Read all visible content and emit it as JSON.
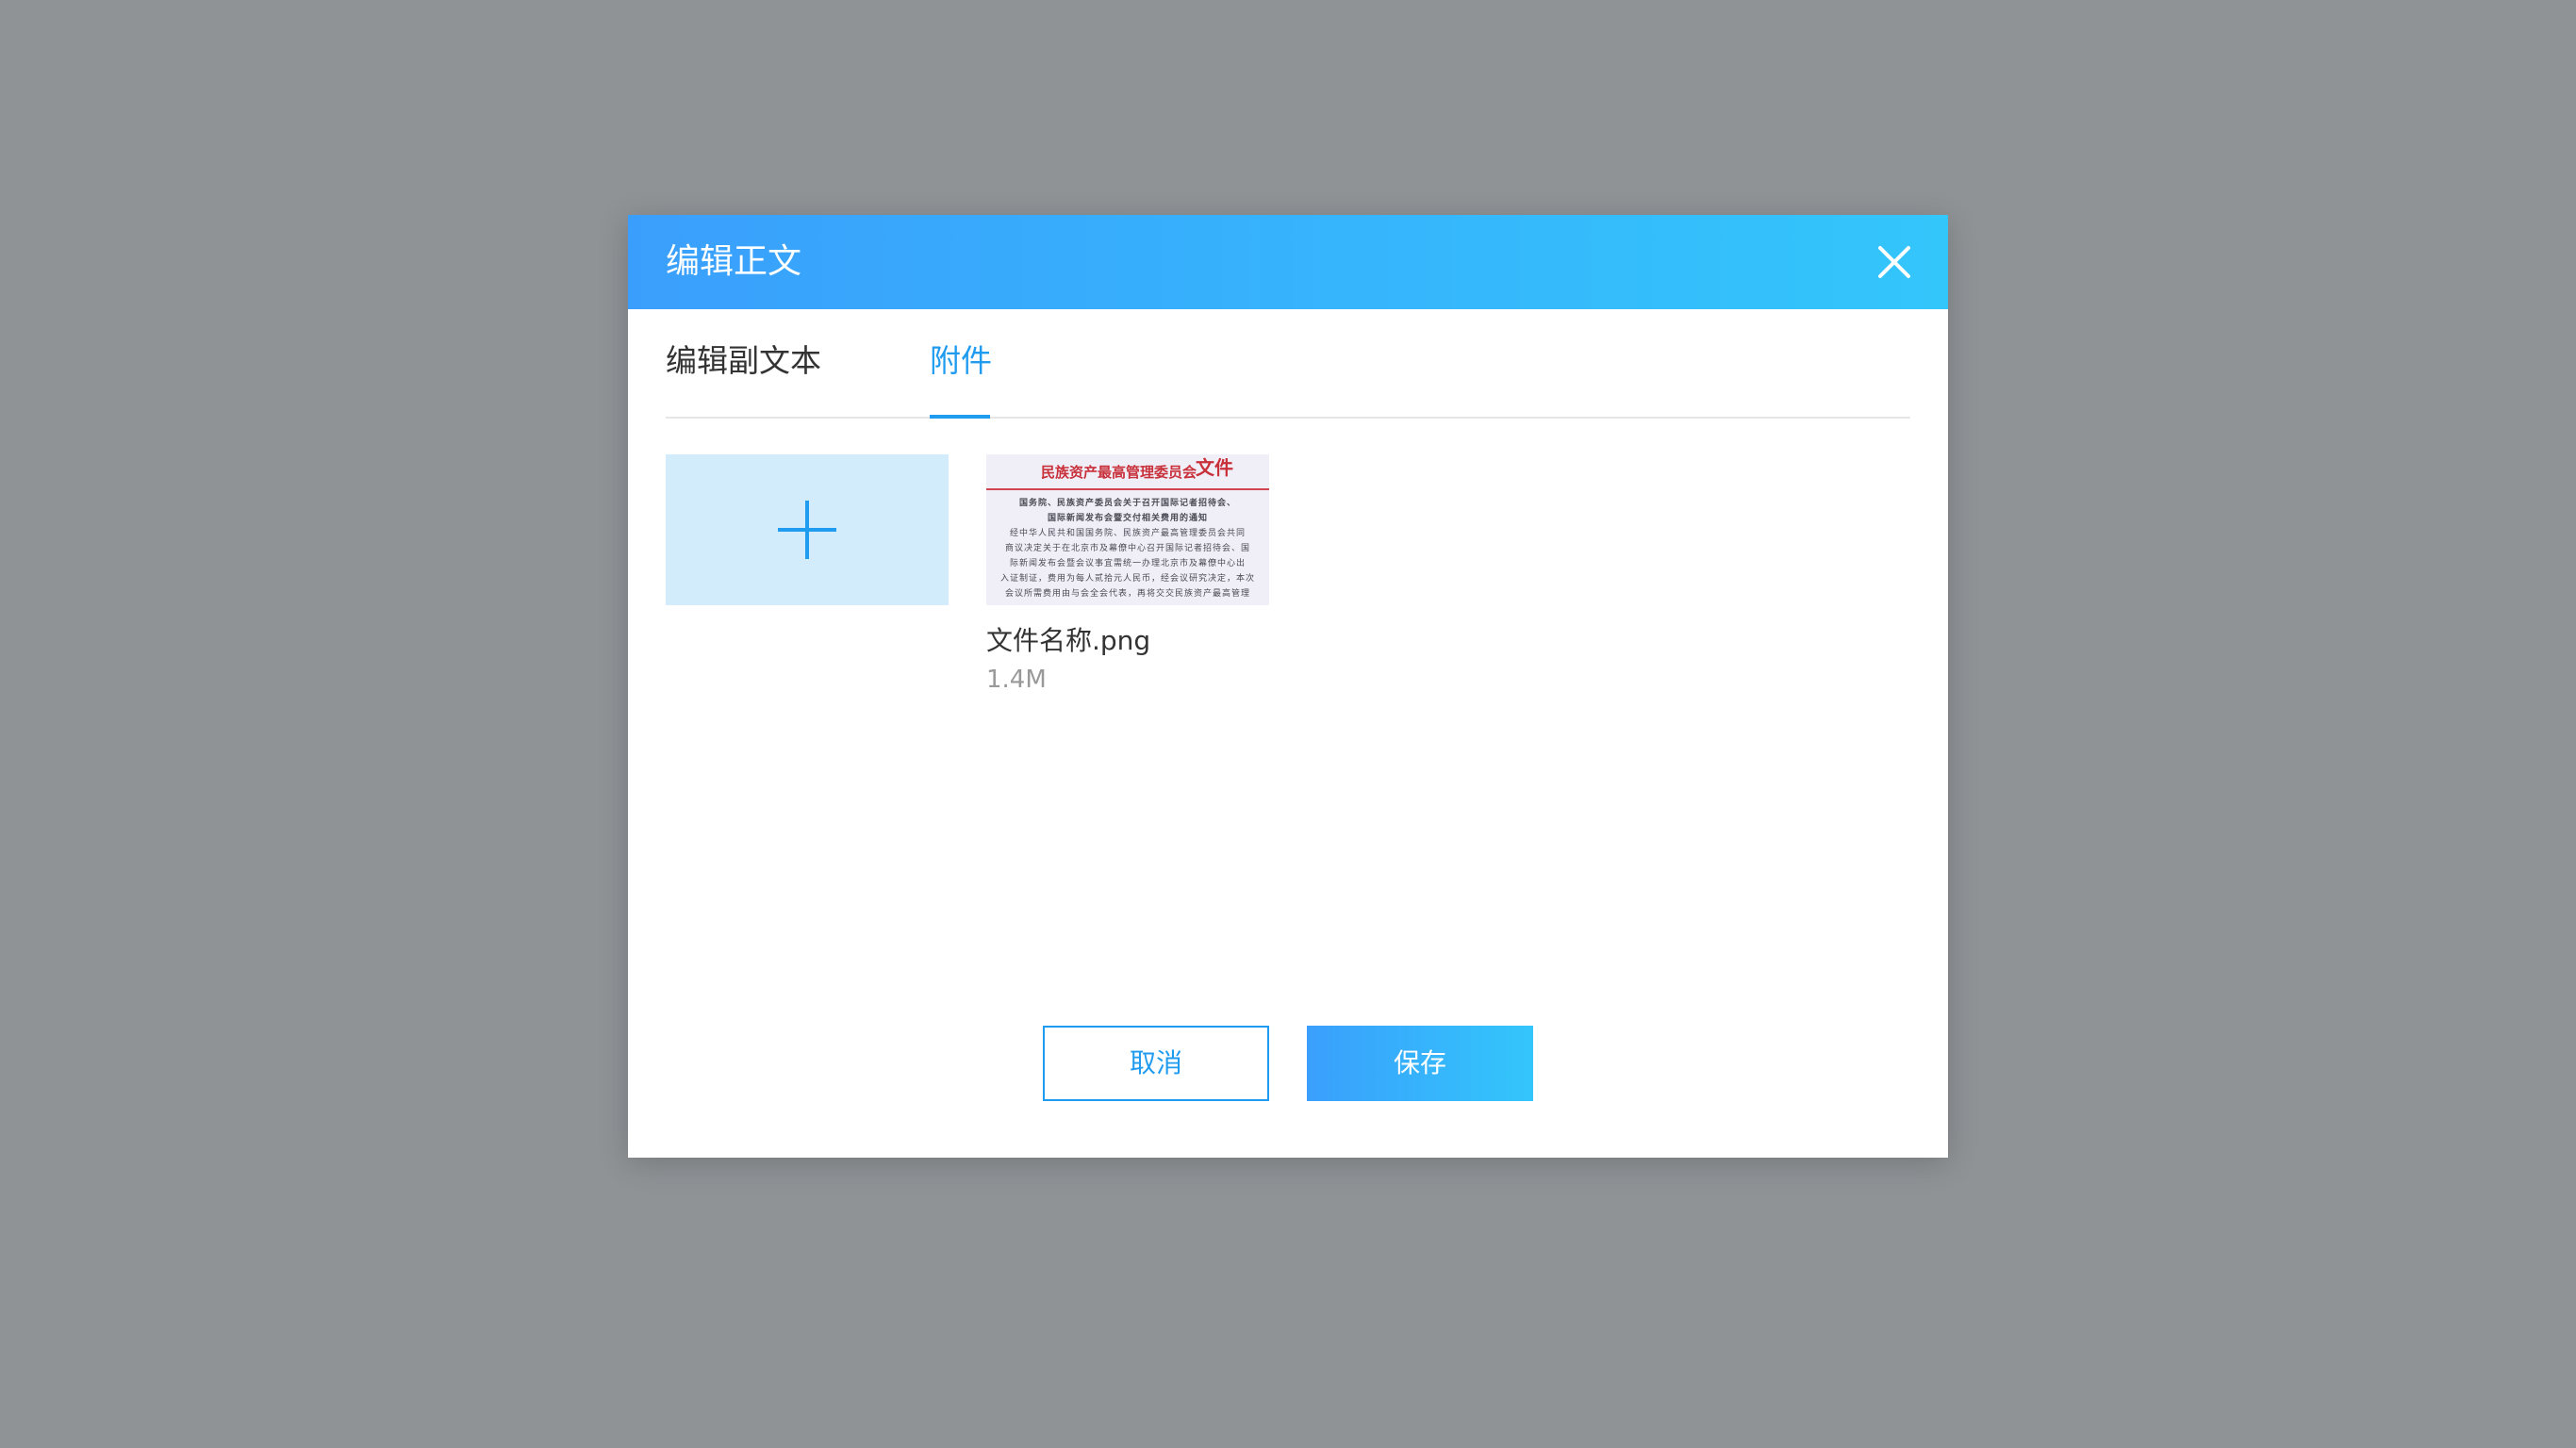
{
  "dialog": {
    "title": "编辑正文",
    "close_icon": "close-icon"
  },
  "tabs": [
    {
      "label": "编辑副文本",
      "active": false
    },
    {
      "label": "附件",
      "active": true
    }
  ],
  "upload": {
    "icon": "plus-icon"
  },
  "attachments": [
    {
      "file_name": "文件名称.png",
      "file_size": "1.4M",
      "thumbnail": {
        "org_title": "民族资产最高管理委员会",
        "doc_label": "文件",
        "lines": [
          "国务院、民族资产委员会关于召开国际记者招待会、",
          "国际新闻发布会暨交付相关费用的通知",
          "经中华人民共和国国务院、民族资产最高管理委员会共同",
          "商议决定关于在北京市及幕僚中心召开国际记者招待会、国",
          "际新闻发布会暨会议事宜需统一办理北京市及幕僚中心出",
          "入证制证，费用为每人贰拾元人民币，经会议研究决定，本次",
          "会议所需费用由与会全会代表，再将交交民族资产最高管理"
        ]
      }
    }
  ],
  "footer": {
    "cancel_label": "取消",
    "save_label": "保存"
  },
  "colors": {
    "accent": "#1f9bf0",
    "header_gradient_start": "#3a9ffc",
    "header_gradient_end": "#33c6fb",
    "overlay": "#8f9396",
    "upload_tile": "#d3ecfc"
  }
}
